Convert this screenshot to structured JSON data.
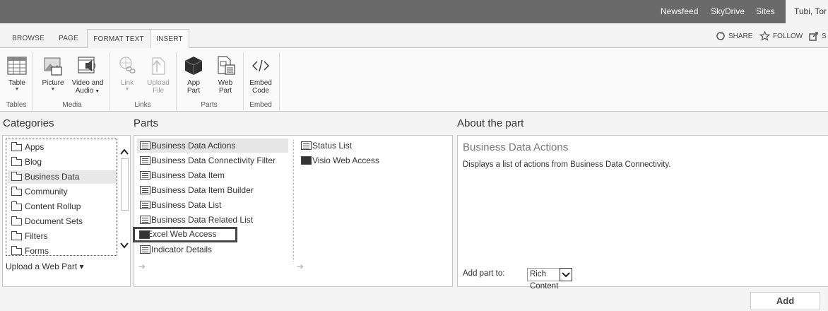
{
  "suite_bar": {
    "links": [
      "Newsfeed",
      "SkyDrive",
      "Sites"
    ],
    "user_name": "Tubi, Tor"
  },
  "ribbon_tabs": [
    "BROWSE",
    "PAGE",
    "FORMAT TEXT",
    "INSERT"
  ],
  "active_tab": "INSERT",
  "top_actions": {
    "share": "SHARE",
    "follow": "FOLLOW",
    "sync": "S"
  },
  "ribbon": {
    "table": "Table",
    "picture": "Picture",
    "video_audio_1": "Video and",
    "video_audio_2": "Audio",
    "link": "Link",
    "upload_1": "Upload",
    "upload_2": "File",
    "app_1": "App",
    "app_2": "Part",
    "web_1": "Web",
    "web_2": "Part",
    "embed_1": "Embed",
    "embed_2": "Code",
    "groups": [
      "Tables",
      "Media",
      "Links",
      "Parts",
      "Embed"
    ]
  },
  "headings": {
    "categories": "Categories",
    "parts": "Parts",
    "about": "About the part"
  },
  "categories": [
    "Apps",
    "Blog",
    "Business Data",
    "Community",
    "Content Rollup",
    "Document Sets",
    "Filters",
    "Forms"
  ],
  "selected_category": "Business Data",
  "upload_web_part": "Upload a Web Part ▾",
  "parts_col1": [
    "Business Data Actions",
    "Business Data Connectivity Filter",
    "Business Data Item",
    "Business Data Item Builder",
    "Business Data List",
    "Business Data Related List",
    "Excel Web Access",
    "Indicator Details"
  ],
  "parts_col2": [
    "Status List",
    "Visio Web Access"
  ],
  "about": {
    "title": "Business Data Actions",
    "description": "Displays a list of actions from Business Data Connectivity.",
    "add_to_label": "Add part to:",
    "add_to_value": "Rich Content"
  },
  "add_button": "Add",
  "icons": [
    "table-icon",
    "picture-icon",
    "video-audio-icon",
    "link-icon",
    "upload-icon",
    "app-part-icon",
    "web-part-icon",
    "embed-code-icon",
    "share-icon",
    "follow-icon",
    "sync-icon",
    "folder-icon",
    "web-part-list-icon",
    "chevron-up-icon",
    "chevron-down-icon"
  ]
}
